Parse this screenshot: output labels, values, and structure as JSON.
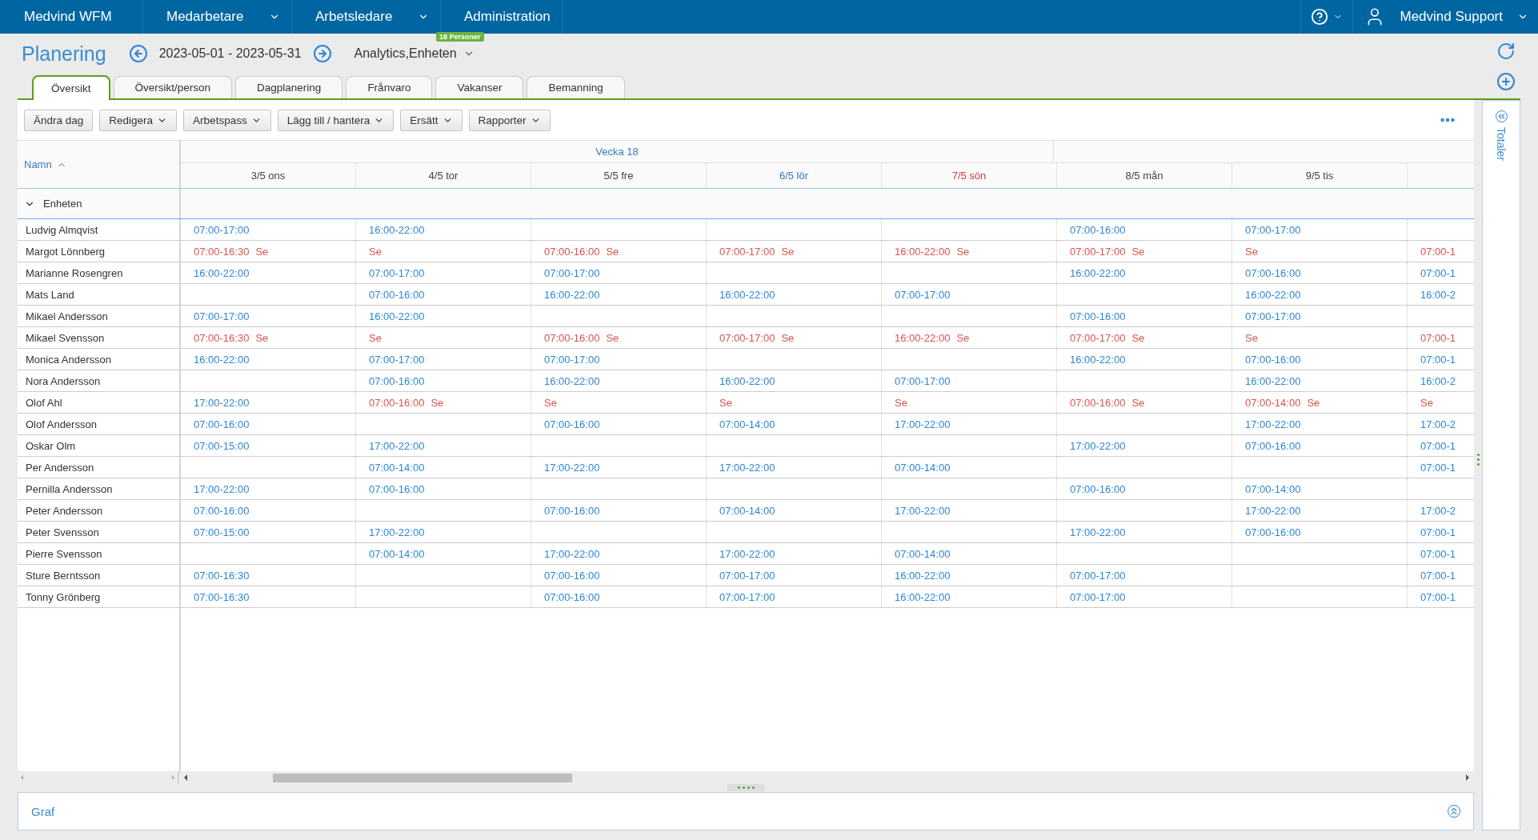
{
  "topbar": {
    "brand": "Medvind WFM",
    "menu": [
      {
        "label": "Medarbetare",
        "dropdown": true
      },
      {
        "label": "Arbetsledare",
        "dropdown": true
      },
      {
        "label": "Administration",
        "dropdown": false
      }
    ],
    "user": "Medvind Support"
  },
  "header": {
    "title": "Planering",
    "date_range": "2023-05-01 - 2023-05-31",
    "unit": "Analytics,Enheten",
    "badge": "18 Personer"
  },
  "tabs": [
    {
      "label": "Översikt",
      "selected": true
    },
    {
      "label": "Översikt/person",
      "selected": false
    },
    {
      "label": "Dagplanering",
      "selected": false
    },
    {
      "label": "Frånvaro",
      "selected": false
    },
    {
      "label": "Vakanser",
      "selected": false
    },
    {
      "label": "Bemanning",
      "selected": false
    }
  ],
  "toolbar": [
    {
      "label": "Ändra dag",
      "dropdown": false
    },
    {
      "label": "Redigera",
      "dropdown": true
    },
    {
      "label": "Arbetspass",
      "dropdown": true
    },
    {
      "label": "Lägg till / hantera",
      "dropdown": true
    },
    {
      "label": "Ersätt",
      "dropdown": true
    },
    {
      "label": "Rapporter",
      "dropdown": true
    }
  ],
  "schedule": {
    "name_header": "Namn",
    "week": "Vecka 18",
    "days": [
      {
        "label": "3/5 ons",
        "kind": "weekday"
      },
      {
        "label": "4/5 tor",
        "kind": "weekday"
      },
      {
        "label": "5/5 fre",
        "kind": "weekday"
      },
      {
        "label": "6/5 lör",
        "kind": "saturday"
      },
      {
        "label": "7/5 sön",
        "kind": "sunday"
      },
      {
        "label": "8/5 mån",
        "kind": "weekday"
      },
      {
        "label": "9/5 tis",
        "kind": "weekday"
      }
    ],
    "group": {
      "label": "Enheten",
      "expanded": true
    },
    "rows": [
      {
        "name": "Ludvig Almqvist",
        "cells": [
          {
            "kind": "shift",
            "time": "07:00-17:00"
          },
          {
            "kind": "shift",
            "time": "16:00-22:00"
          },
          null,
          null,
          null,
          {
            "kind": "shift",
            "time": "07:00-16:00"
          },
          {
            "kind": "shift",
            "time": "07:00-17:00"
          },
          null
        ]
      },
      {
        "name": "Margot Lönnberg",
        "cells": [
          {
            "kind": "absence",
            "time": "07:00-16:30",
            "code": "Se"
          },
          {
            "kind": "absence",
            "code": "Se"
          },
          {
            "kind": "absence",
            "time": "07:00-16:00",
            "code": "Se"
          },
          {
            "kind": "absence",
            "time": "07:00-17:00",
            "code": "Se"
          },
          {
            "kind": "absence",
            "time": "16:00-22:00",
            "code": "Se"
          },
          {
            "kind": "absence",
            "time": "07:00-17:00",
            "code": "Se"
          },
          {
            "kind": "absence",
            "code": "Se"
          },
          {
            "kind": "absence",
            "time": "07:00-1"
          }
        ]
      },
      {
        "name": "Marianne Rosengren",
        "cells": [
          {
            "kind": "shift",
            "time": "16:00-22:00"
          },
          {
            "kind": "shift",
            "time": "07:00-17:00"
          },
          {
            "kind": "shift",
            "time": "07:00-17:00"
          },
          null,
          null,
          {
            "kind": "shift",
            "time": "16:00-22:00"
          },
          {
            "kind": "shift",
            "time": "07:00-16:00"
          },
          {
            "kind": "shift",
            "time": "07:00-1"
          }
        ]
      },
      {
        "name": "Mats Land",
        "cells": [
          null,
          {
            "kind": "shift",
            "time": "07:00-16:00"
          },
          {
            "kind": "shift",
            "time": "16:00-22:00"
          },
          {
            "kind": "shift",
            "time": "16:00-22:00"
          },
          {
            "kind": "shift",
            "time": "07:00-17:00"
          },
          null,
          {
            "kind": "shift",
            "time": "16:00-22:00"
          },
          {
            "kind": "shift",
            "time": "16:00-2"
          }
        ]
      },
      {
        "name": "Mikael Andersson",
        "cells": [
          {
            "kind": "shift",
            "time": "07:00-17:00"
          },
          {
            "kind": "shift",
            "time": "16:00-22:00"
          },
          null,
          null,
          null,
          {
            "kind": "shift",
            "time": "07:00-16:00"
          },
          {
            "kind": "shift",
            "time": "07:00-17:00"
          },
          null
        ]
      },
      {
        "name": "Mikael Svensson",
        "cells": [
          {
            "kind": "absence",
            "time": "07:00-16:30",
            "code": "Se"
          },
          {
            "kind": "absence",
            "code": "Se"
          },
          {
            "kind": "absence",
            "time": "07:00-16:00",
            "code": "Se"
          },
          {
            "kind": "absence",
            "time": "07:00-17:00",
            "code": "Se"
          },
          {
            "kind": "absence",
            "time": "16:00-22:00",
            "code": "Se"
          },
          {
            "kind": "absence",
            "time": "07:00-17:00",
            "code": "Se"
          },
          {
            "kind": "absence",
            "code": "Se"
          },
          {
            "kind": "absence",
            "time": "07:00-1"
          }
        ]
      },
      {
        "name": "Monica Andersson",
        "cells": [
          {
            "kind": "shift",
            "time": "16:00-22:00"
          },
          {
            "kind": "shift",
            "time": "07:00-17:00"
          },
          {
            "kind": "shift",
            "time": "07:00-17:00"
          },
          null,
          null,
          {
            "kind": "shift",
            "time": "16:00-22:00"
          },
          {
            "kind": "shift",
            "time": "07:00-16:00"
          },
          {
            "kind": "shift",
            "time": "07:00-1"
          }
        ]
      },
      {
        "name": "Nora Andersson",
        "cells": [
          null,
          {
            "kind": "shift",
            "time": "07:00-16:00"
          },
          {
            "kind": "shift",
            "time": "16:00-22:00"
          },
          {
            "kind": "shift",
            "time": "16:00-22:00"
          },
          {
            "kind": "shift",
            "time": "07:00-17:00"
          },
          null,
          {
            "kind": "shift",
            "time": "16:00-22:00"
          },
          {
            "kind": "shift",
            "time": "16:00-2"
          }
        ]
      },
      {
        "name": "Olof Ahl",
        "cells": [
          {
            "kind": "shift",
            "time": "17:00-22:00"
          },
          {
            "kind": "absence",
            "time": "07:00-16:00",
            "code": "Se"
          },
          {
            "kind": "absence",
            "code": "Se"
          },
          {
            "kind": "absence",
            "code": "Se"
          },
          {
            "kind": "absence",
            "code": "Se"
          },
          {
            "kind": "absence",
            "time": "07:00-16:00",
            "code": "Se"
          },
          {
            "kind": "absence",
            "time": "07:00-14:00",
            "code": "Se"
          },
          {
            "kind": "absence",
            "code": "Se"
          }
        ]
      },
      {
        "name": "Olof Andersson",
        "cells": [
          {
            "kind": "shift",
            "time": "07:00-16:00"
          },
          null,
          {
            "kind": "shift",
            "time": "07:00-16:00"
          },
          {
            "kind": "shift",
            "time": "07:00-14:00"
          },
          {
            "kind": "shift",
            "time": "17:00-22:00"
          },
          null,
          {
            "kind": "shift",
            "time": "17:00-22:00"
          },
          {
            "kind": "shift",
            "time": "17:00-2"
          }
        ]
      },
      {
        "name": "Oskar Olm",
        "cells": [
          {
            "kind": "shift",
            "time": "07:00-15:00"
          },
          {
            "kind": "shift",
            "time": "17:00-22:00"
          },
          null,
          null,
          null,
          {
            "kind": "shift",
            "time": "17:00-22:00"
          },
          {
            "kind": "shift",
            "time": "07:00-16:00"
          },
          {
            "kind": "shift",
            "time": "07:00-1"
          }
        ]
      },
      {
        "name": "Per Andersson",
        "cells": [
          null,
          {
            "kind": "shift",
            "time": "07:00-14:00"
          },
          {
            "kind": "shift",
            "time": "17:00-22:00"
          },
          {
            "kind": "shift",
            "time": "17:00-22:00"
          },
          {
            "kind": "shift",
            "time": "07:00-14:00"
          },
          null,
          null,
          {
            "kind": "shift",
            "time": "07:00-1"
          }
        ]
      },
      {
        "name": "Pernilla Andersson",
        "cells": [
          {
            "kind": "shift",
            "time": "17:00-22:00"
          },
          {
            "kind": "shift",
            "time": "07:00-16:00"
          },
          null,
          null,
          null,
          {
            "kind": "shift",
            "time": "07:00-16:00"
          },
          {
            "kind": "shift",
            "time": "07:00-14:00"
          },
          null
        ]
      },
      {
        "name": "Peter Andersson",
        "cells": [
          {
            "kind": "shift",
            "time": "07:00-16:00"
          },
          null,
          {
            "kind": "shift",
            "time": "07:00-16:00"
          },
          {
            "kind": "shift",
            "time": "07:00-14:00"
          },
          {
            "kind": "shift",
            "time": "17:00-22:00"
          },
          null,
          {
            "kind": "shift",
            "time": "17:00-22:00"
          },
          {
            "kind": "shift",
            "time": "17:00-2"
          }
        ]
      },
      {
        "name": "Peter Svensson",
        "cells": [
          {
            "kind": "shift",
            "time": "07:00-15:00"
          },
          {
            "kind": "shift",
            "time": "17:00-22:00"
          },
          null,
          null,
          null,
          {
            "kind": "shift",
            "time": "17:00-22:00"
          },
          {
            "kind": "shift",
            "time": "07:00-16:00"
          },
          {
            "kind": "shift",
            "time": "07:00-1"
          }
        ]
      },
      {
        "name": "Pierre Svensson",
        "cells": [
          null,
          {
            "kind": "shift",
            "time": "07:00-14:00"
          },
          {
            "kind": "shift",
            "time": "17:00-22:00"
          },
          {
            "kind": "shift",
            "time": "17:00-22:00"
          },
          {
            "kind": "shift",
            "time": "07:00-14:00"
          },
          null,
          null,
          {
            "kind": "shift",
            "time": "07:00-1"
          }
        ]
      },
      {
        "name": "Sture Berntsson",
        "cells": [
          {
            "kind": "shift",
            "time": "07:00-16:30"
          },
          null,
          {
            "kind": "shift",
            "time": "07:00-16:00"
          },
          {
            "kind": "shift",
            "time": "07:00-17:00"
          },
          {
            "kind": "shift",
            "time": "16:00-22:00"
          },
          {
            "kind": "shift",
            "time": "07:00-17:00"
          },
          null,
          {
            "kind": "shift",
            "time": "07:00-1"
          }
        ]
      },
      {
        "name": "Tonny Grönberg",
        "cells": [
          {
            "kind": "shift",
            "time": "07:00-16:30"
          },
          null,
          {
            "kind": "shift",
            "time": "07:00-16:00"
          },
          {
            "kind": "shift",
            "time": "07:00-17:00"
          },
          {
            "kind": "shift",
            "time": "16:00-22:00"
          },
          {
            "kind": "shift",
            "time": "07:00-17:00"
          },
          null,
          {
            "kind": "shift",
            "time": "07:00-1"
          }
        ]
      }
    ]
  },
  "bottom_panel": {
    "title": "Graf"
  },
  "side_panel": {
    "title": "Totaler"
  }
}
